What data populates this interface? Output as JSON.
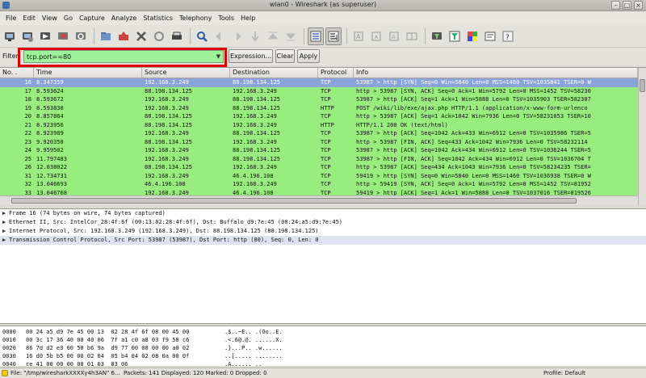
{
  "window": {
    "title": "wlan0 - Wireshark (as superuser)"
  },
  "menu": [
    "File",
    "Edit",
    "View",
    "Go",
    "Capture",
    "Analyze",
    "Statistics",
    "Telephony",
    "Tools",
    "Help"
  ],
  "toolbar_icons": [
    "interface-list-icon",
    "capture-options-icon",
    "start-capture-icon",
    "stop-capture-icon",
    "restart-capture-icon",
    "open-file-icon",
    "save-file-icon",
    "close-file-icon",
    "reload-icon",
    "print-icon",
    "find-packet-icon",
    "go-back-icon",
    "go-forward-icon",
    "go-to-packet-icon",
    "go-first-icon",
    "go-last-icon",
    "colorize-icon",
    "autoscroll-icon",
    "zoom-in-icon",
    "zoom-out-icon",
    "zoom-normal-icon",
    "resize-columns-icon",
    "capture-filters-icon",
    "display-filters-icon",
    "coloring-rules-icon",
    "preferences-icon",
    "help-icon"
  ],
  "filter": {
    "label": "Filter:",
    "value": "tcp.port==80",
    "expression_label": "Expression...",
    "clear_label": "Clear",
    "apply_label": "Apply",
    "highlight_color": "#e00000",
    "valid_color": "#9ef29a"
  },
  "packet_list": {
    "columns": [
      "No. .",
      "Time",
      "Source",
      "Destination",
      "Protocol",
      "Info"
    ],
    "rows": [
      {
        "no": "16",
        "time": "8.347359",
        "src": "192.168.3.249",
        "dst": "88.198.134.125",
        "proto": "TCP",
        "info": "53987 > http [SYN] Seq=0 Win=5840 Len=0 MSS=1460 TSV=1035841 TSER=0 W",
        "selected": true
      },
      {
        "no": "17",
        "time": "8.593624",
        "src": "88.198.134.125",
        "dst": "192.168.3.249",
        "proto": "TCP",
        "info": "http > 53987 [SYN, ACK] Seq=0 Ack=1 Win=5792 Len=0 MSS=1452 TSV=58230"
      },
      {
        "no": "18",
        "time": "8.593672",
        "src": "192.168.3.249",
        "dst": "88.198.134.125",
        "proto": "TCP",
        "info": "53987 > http [ACK] Seq=1 Ack=1 Win=5888 Len=0 TSV=1035903 TSER=582307"
      },
      {
        "no": "19",
        "time": "8.593830",
        "src": "192.168.3.249",
        "dst": "88.198.134.125",
        "proto": "HTTP",
        "info": "POST /wiki/lib/exe/ajax.php HTTP/1.1  (application/x-www-form-urlenco"
      },
      {
        "no": "20",
        "time": "8.857864",
        "src": "88.198.134.125",
        "dst": "192.168.3.249",
        "proto": "TCP",
        "info": "http > 53987 [ACK] Seq=1 Ack=1042 Win=7936 Len=0 TSV=58231053 TSER=10"
      },
      {
        "no": "21",
        "time": "8.923956",
        "src": "88.198.134.125",
        "dst": "192.168.3.249",
        "proto": "HTTP",
        "info": "HTTP/1.1 200 OK  (text/html)"
      },
      {
        "no": "22",
        "time": "8.923989",
        "src": "192.168.3.249",
        "dst": "88.198.134.125",
        "proto": "TCP",
        "info": "53987 > http [ACK] Seq=1042 Ack=433 Win=6912 Len=0 TSV=1035986 TSER=5"
      },
      {
        "no": "23",
        "time": "9.920350",
        "src": "88.198.134.125",
        "dst": "192.168.3.249",
        "proto": "TCP",
        "info": "http > 53987 [FIN, ACK] Seq=433 Ack=1042 Win=7936 Len=0 TSV=58232114"
      },
      {
        "no": "24",
        "time": "9.959502",
        "src": "192.168.3.249",
        "dst": "88.198.134.125",
        "proto": "TCP",
        "info": "53987 > http [ACK] Seq=1042 Ack=434 Win=6912 Len=0 TSV=1036244 TSER=5"
      },
      {
        "no": "25",
        "time": "11.797483",
        "src": "192.168.3.249",
        "dst": "88.198.134.125",
        "proto": "TCP",
        "info": "53987 > http [FIN, ACK] Seq=1042 Ack=434 Win=6912 Len=0 TSV=1036704 T"
      },
      {
        "no": "26",
        "time": "12.038022",
        "src": "88.198.134.125",
        "dst": "192.168.3.249",
        "proto": "TCP",
        "info": "http > 53987 [ACK] Seq=434 Ack=1043 Win=7936 Len=0 TSV=58234235 TSER="
      },
      {
        "no": "31",
        "time": "12.734731",
        "src": "192.168.3.249",
        "dst": "46.4.196.108",
        "proto": "TCP",
        "info": "59419 > http [SYN] Seq=0 Win=5840 Len=0 MSS=1460 TSV=1036938 TSER=0 W"
      },
      {
        "no": "32",
        "time": "13.046693",
        "src": "46.4.196.108",
        "dst": "192.168.3.249",
        "proto": "TCP",
        "info": "http > 59419 [SYN, ACK] Seq=0 Ack=1 Win=5792 Len=0 MSS=1452 TSV=81952"
      },
      {
        "no": "33",
        "time": "13.046768",
        "src": "192.168.3.249",
        "dst": "46.4.196.108",
        "proto": "TCP",
        "info": "59419 > http [ACK] Seq=1 Ack=1 Win=5888 Len=0 TSV=1037016 TSER=819526"
      }
    ]
  },
  "details": [
    {
      "text": "Frame 16 (74 bytes on wire, 74 bytes captured)",
      "selected": false
    },
    {
      "text": "Ethernet II, Src: IntelCor_28:4f:6f (00:13:02:28:4f:6f), Dst: Buffalo_d9:7e:45 (00:24:a5:d9:7e:45)",
      "selected": false
    },
    {
      "text": "Internet Protocol, Src: 192.168.3.249 (192.168.3.249), Dst: 88.198.134.125 (88.198.134.125)",
      "selected": false
    },
    {
      "text": "Transmission Control Protocol, Src Port: 53987 (53987), Dst Port: http (80), Seq: 0, Len: 0",
      "selected": true
    }
  ],
  "bytes": [
    {
      "off": "0000",
      "hex": "00 24 a5 d9 7e 45 00 13  02 28 4f 6f 08 00 45 00",
      "ascii": ".$..~E.. .(Oo..E."
    },
    {
      "off": "0010",
      "hex": "00 3c 17 36 40 00 40 06  7f a1 c0 a8 03 f9 58 c6",
      "ascii": ".<.6@.@. ......X."
    },
    {
      "off": "0020",
      "hex": "86 7d d2 e3 00 50 b6 9a  d9 77 00 00 00 00 a0 02",
      "ascii": ".}...P.. .w......"
    },
    {
      "off": "0030",
      "hex": "16 d0 5b b5 00 00 02 04  05 b4 04 02 08 0a 00 0f",
      "ascii": "..[..... ........"
    },
    {
      "off": "0040",
      "hex": "ce 41 00 00 00 00 01 03  03 06",
      "ascii": ".A...... .."
    }
  ],
  "status": {
    "file": "File: \"/tmp/wiresharkXXXXy4h3AN\" 6...",
    "packets": "Packets: 141 Displayed: 120 Marked: 0 Dropped: 0",
    "profile": "Profile: Default"
  }
}
